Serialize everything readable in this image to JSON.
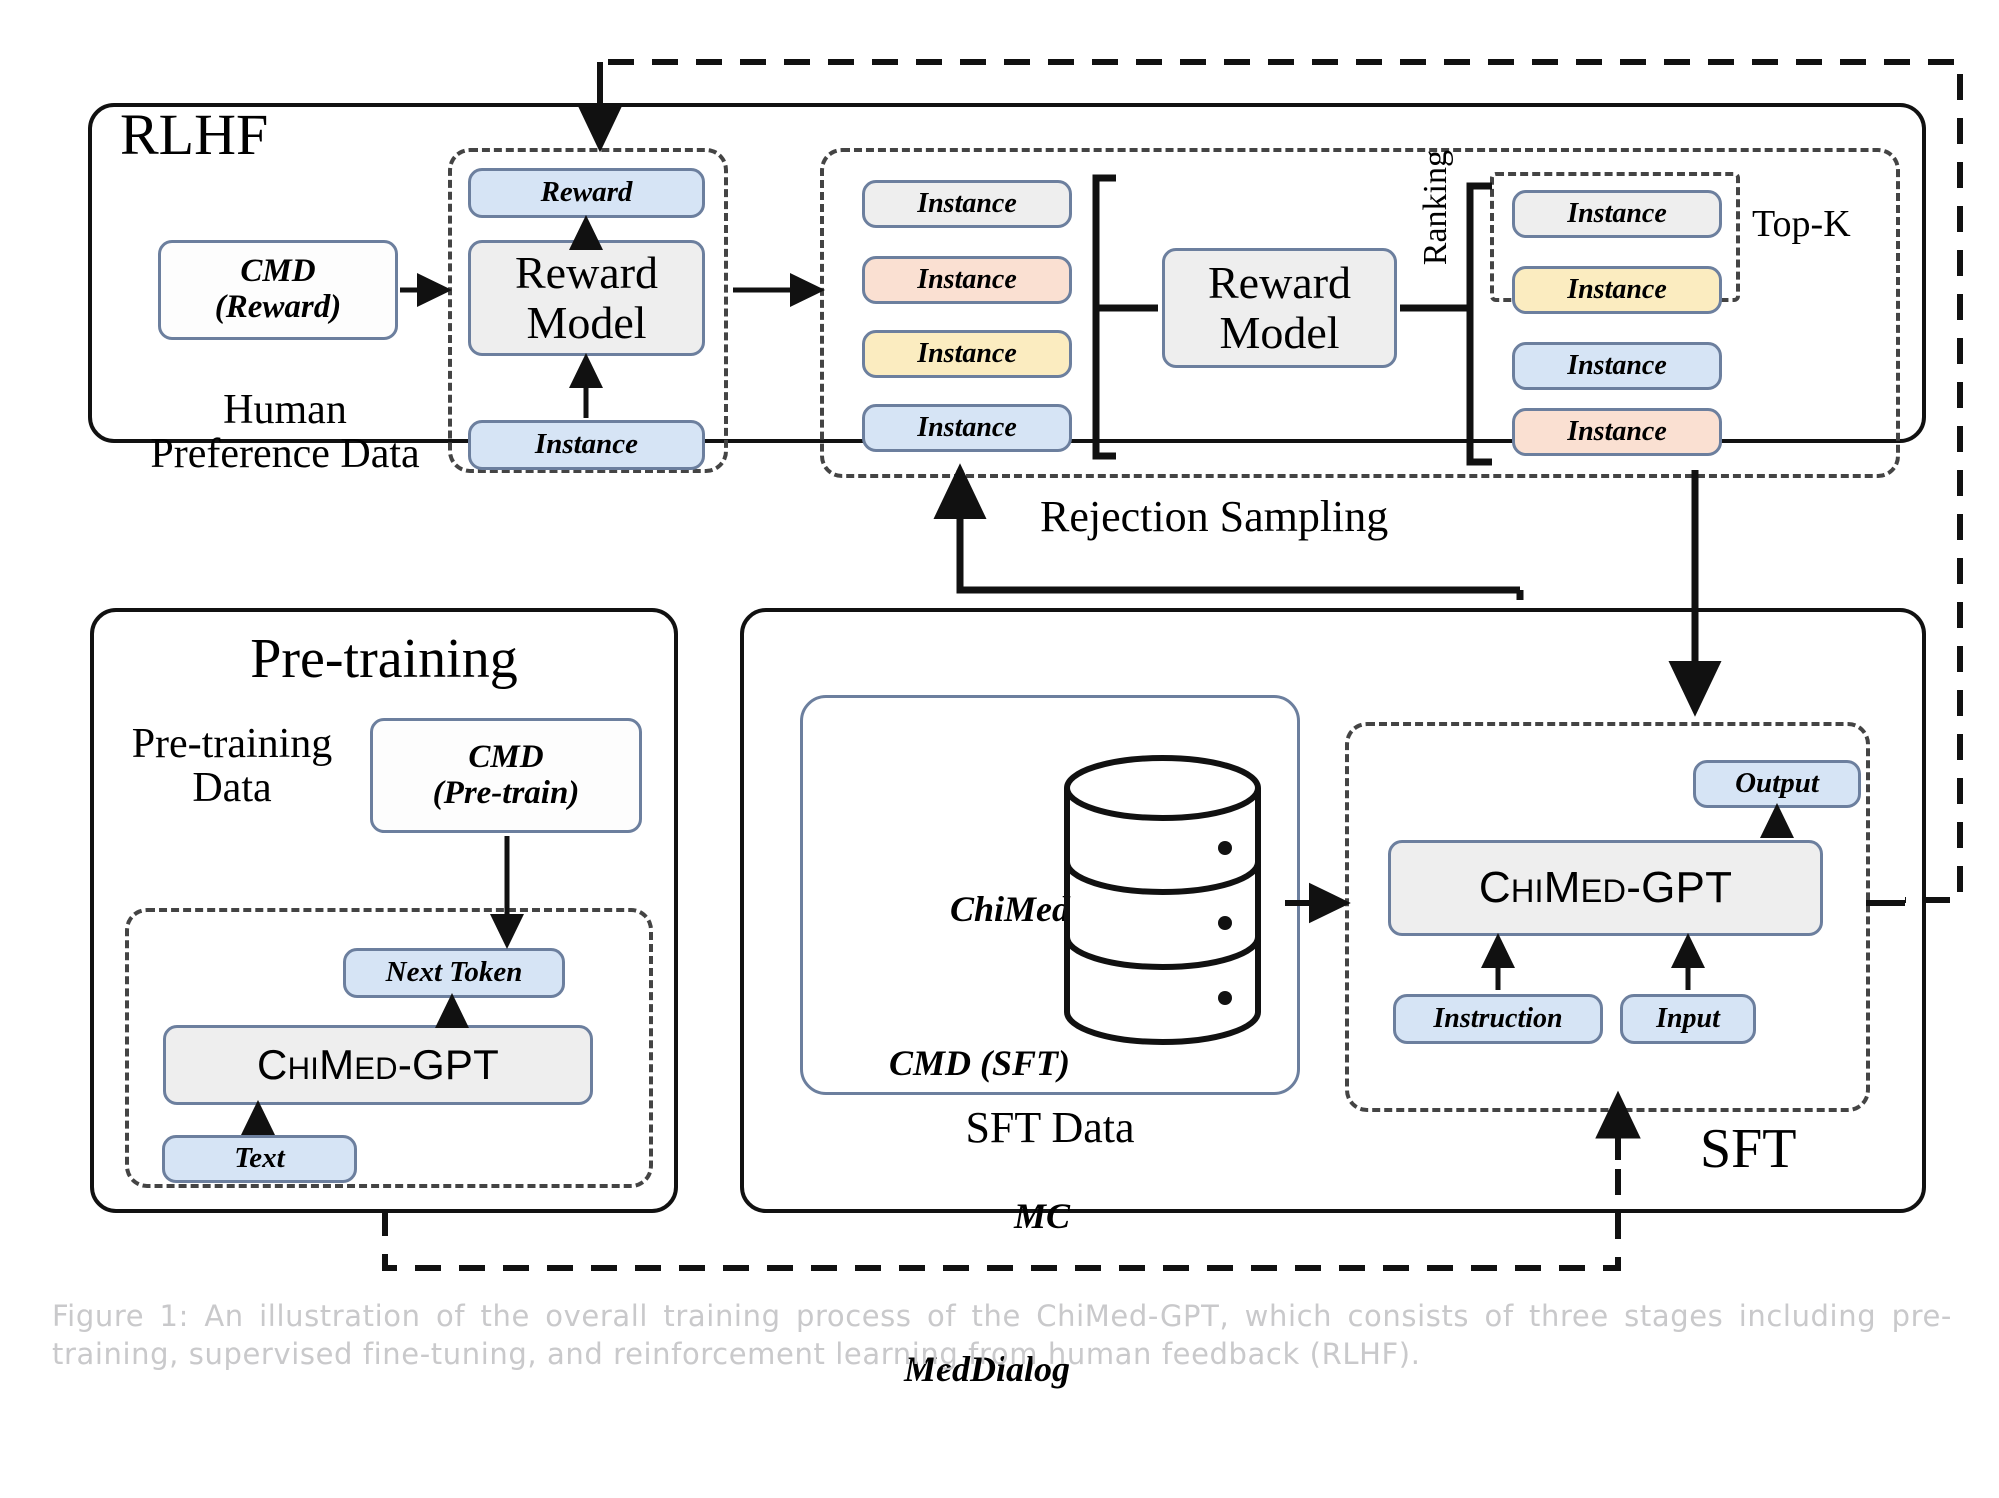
{
  "figure": {
    "caption": "Figure 1: An illustration of the overall training process of the ChiMed-GPT, which consists of three stages including pre-training, supervised fine-tuning, and reinforcement learning from human feedback (RLHF)."
  },
  "colors": {
    "outline": "#111111",
    "dashed": "#444444",
    "node_border": "#6c7f9e",
    "blue": "#d6e4f5",
    "peach": "#fae0d2",
    "yellow": "#fbecc0",
    "grey": "#eeeeee",
    "caption_text": "#c9c9cb"
  },
  "rlhf": {
    "title": "RLHF",
    "human_preference_data_label": "Human\nPreference Data",
    "cmd_reward": "CMD\n(Reward)",
    "reward_model_group": {
      "reward_output": "Reward",
      "model": "Reward\nModel",
      "instance_input": "Instance"
    },
    "rejection_sampling": {
      "label": "Rejection Sampling",
      "candidates": [
        {
          "label": "Instance",
          "color": "grey"
        },
        {
          "label": "Instance",
          "color": "peach"
        },
        {
          "label": "Instance",
          "color": "yellow"
        },
        {
          "label": "Instance",
          "color": "blue"
        }
      ],
      "scorer_model": "Reward\nModel",
      "ranking_label": "Ranking",
      "topk_label": "Top-K",
      "ranked": [
        {
          "label": "Instance",
          "color": "grey",
          "in_topk": true
        },
        {
          "label": "Instance",
          "color": "yellow",
          "in_topk": true
        },
        {
          "label": "Instance",
          "color": "blue",
          "in_topk": false
        },
        {
          "label": "Instance",
          "color": "peach",
          "in_topk": false
        }
      ]
    }
  },
  "pretraining": {
    "title": "Pre-training",
    "data_label": "Pre-training\nData",
    "cmd_pretrain": "CMD\n(Pre-train)",
    "next_token": "Next Token",
    "model": "ChiMed-GPT",
    "text_input": "Text"
  },
  "sft": {
    "title": "SFT",
    "data_label": "SFT Data",
    "datasets": [
      "ChiMed",
      "CMD (SFT)",
      "MC",
      "MedDialog"
    ],
    "database_icon": "database-cylinder-icon",
    "model": "ChiMed-GPT",
    "output": "Output",
    "instruction": "Instruction",
    "input": "Input"
  }
}
